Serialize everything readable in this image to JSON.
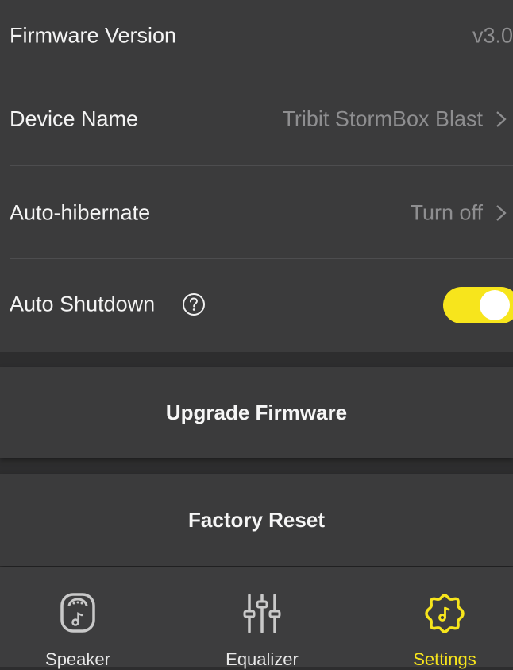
{
  "settings": {
    "firmware": {
      "label": "Firmware Version",
      "value": "v3.0"
    },
    "device_name": {
      "label": "Device Name",
      "value": "Tribit StormBox Blast"
    },
    "auto_hibernate": {
      "label": "Auto-hibernate",
      "value": "Turn off"
    },
    "auto_shutdown": {
      "label": "Auto Shutdown",
      "enabled": true
    }
  },
  "actions": {
    "upgrade_label": "Upgrade Firmware",
    "reset_label": "Factory Reset"
  },
  "nav": {
    "items": [
      {
        "label": "Speaker",
        "icon": "speaker-icon",
        "active": false
      },
      {
        "label": "Equalizer",
        "icon": "equalizer-icon",
        "active": false
      },
      {
        "label": "Settings",
        "icon": "settings-icon",
        "active": true
      }
    ]
  },
  "colors": {
    "accent": "#f7e51c",
    "background": "#2d2d2e",
    "card": "#3b3b3c",
    "muted_text": "#8e8e90"
  }
}
